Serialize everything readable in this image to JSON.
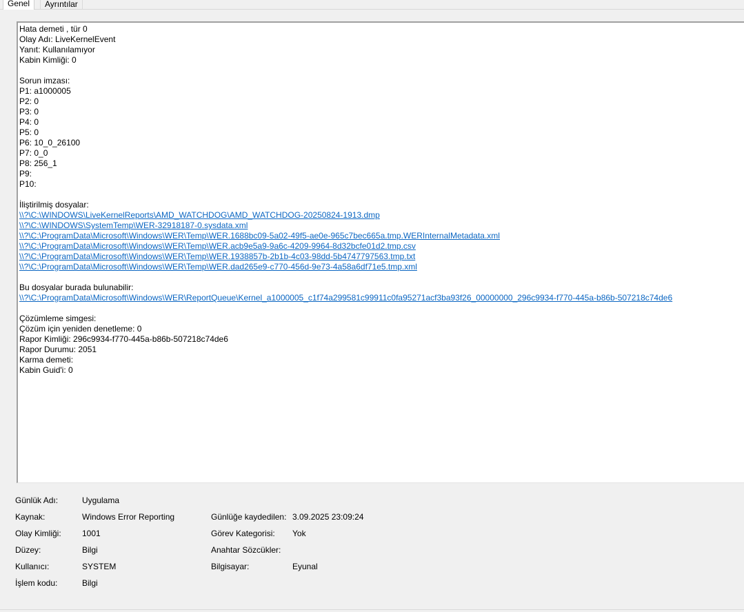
{
  "tabs": {
    "general": "Genel",
    "details": "Ayrıntılar"
  },
  "description": {
    "lines": [
      {
        "text": "Hata demeti , tür 0"
      },
      {
        "text": "Olay Adı: LiveKernelEvent"
      },
      {
        "text": "Yanıt: Kullanılamıyor"
      },
      {
        "text": "Kabin Kimliği: 0"
      },
      {
        "text": ""
      },
      {
        "text": "Sorun imzası:"
      },
      {
        "text": "P1: a1000005"
      },
      {
        "text": "P2: 0"
      },
      {
        "text": "P3: 0"
      },
      {
        "text": "P4: 0"
      },
      {
        "text": "P5: 0"
      },
      {
        "text": "P6: 10_0_26100"
      },
      {
        "text": "P7: 0_0"
      },
      {
        "text": "P8: 256_1"
      },
      {
        "text": "P9:"
      },
      {
        "text": "P10:"
      },
      {
        "text": ""
      },
      {
        "text": "İliştirilmiş dosyalar:"
      },
      {
        "text": "\\\\?\\C:\\WINDOWS\\LiveKernelReports\\AMD_WATCHDOG\\AMD_WATCHDOG-20250824-1913.dmp",
        "link": true
      },
      {
        "text": "\\\\?\\C:\\WINDOWS\\SystemTemp\\WER-32918187-0.sysdata.xml",
        "link": true
      },
      {
        "text": "\\\\?\\C:\\ProgramData\\Microsoft\\Windows\\WER\\Temp\\WER.1688bc09-5a02-49f5-ae0e-965c7bec665a.tmp.WERInternalMetadata.xml",
        "link": true
      },
      {
        "text": "\\\\?\\C:\\ProgramData\\Microsoft\\Windows\\WER\\Temp\\WER.acb9e5a9-9a6c-4209-9964-8d32bcfe01d2.tmp.csv",
        "link": true
      },
      {
        "text": "\\\\?\\C:\\ProgramData\\Microsoft\\Windows\\WER\\Temp\\WER.1938857b-2b1b-4c03-98dd-5b4747797563.tmp.txt",
        "link": true
      },
      {
        "text": "\\\\?\\C:\\ProgramData\\Microsoft\\Windows\\WER\\Temp\\WER.dad265e9-c770-456d-9e73-4a58a6df71e5.tmp.xml",
        "link": true
      },
      {
        "text": ""
      },
      {
        "text": "Bu dosyalar burada bulunabilir:"
      },
      {
        "text": "\\\\?\\C:\\ProgramData\\Microsoft\\Windows\\WER\\ReportQueue\\Kernel_a1000005_c1f74a299581c99911c0fa95271acf3ba93f26_00000000_296c9934-f770-445a-b86b-507218c74de6",
        "link": true
      },
      {
        "text": ""
      },
      {
        "text": "Çözümleme simgesi:"
      },
      {
        "text": "Çözüm için yeniden denetleme: 0"
      },
      {
        "text": "Rapor Kimliği: 296c9934-f770-445a-b86b-507218c74de6"
      },
      {
        "text": "Rapor Durumu: 2051"
      },
      {
        "text": "Karma demeti:"
      },
      {
        "text": "Kabin Guid'i: 0"
      }
    ]
  },
  "properties": {
    "log_name_label": "Günlük Adı:",
    "log_name_value": "Uygulama",
    "source_label": "Kaynak:",
    "source_value": "Windows Error Reporting",
    "logged_label": "Günlüğe kaydedilen:",
    "logged_value": "3.09.2025 23:09:24",
    "event_id_label": "Olay Kimliği:",
    "event_id_value": "1001",
    "task_category_label": "Görev Kategorisi:",
    "task_category_value": "Yok",
    "level_label": "Düzey:",
    "level_value": "Bilgi",
    "keywords_label": "Anahtar Sözcükler:",
    "keywords_value": "",
    "user_label": "Kullanıcı:",
    "user_value": "SYSTEM",
    "computer_label": "Bilgisayar:",
    "computer_value": "Eyunal",
    "opcode_label": "İşlem kodu:",
    "opcode_value": "Bilgi"
  },
  "colors": {
    "link": "#0b66c2",
    "background": "#f0f0f0",
    "box": "#ffffff"
  }
}
